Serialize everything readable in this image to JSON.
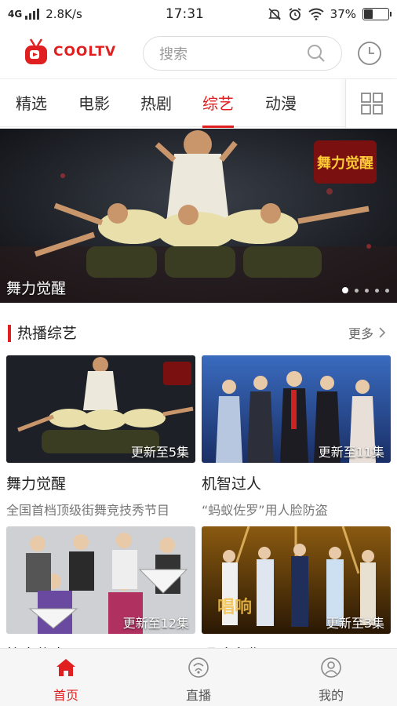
{
  "status_bar": {
    "network": "4G",
    "speed": "2.8K/s",
    "time": "17:31",
    "battery_text": "37%",
    "battery_level": 0.37
  },
  "header": {
    "logo_text": "COOLTV",
    "search_placeholder": "搜索"
  },
  "tabs": [
    {
      "label": "精选",
      "active": false
    },
    {
      "label": "电影",
      "active": false
    },
    {
      "label": "热剧",
      "active": false
    },
    {
      "label": "综艺",
      "active": true
    },
    {
      "label": "动漫",
      "active": false
    }
  ],
  "banner": {
    "caption": "舞力觉醒",
    "slide_count": 5,
    "active_slide": 1
  },
  "section": {
    "title": "热播综艺",
    "more_label": "更多"
  },
  "cards": [
    {
      "title": "舞力觉醒",
      "subtitle": "全国首档顶级街舞竞技秀节目",
      "badge": "更新至5集"
    },
    {
      "title": "机智过人",
      "subtitle": "“蚂蚁佐罗”用人脸防盗",
      "badge": "更新至11集"
    },
    {
      "title": "笑声传奇",
      "subtitle": "",
      "badge": "更新至12集"
    },
    {
      "title": "唱响中华",
      "subtitle": "",
      "badge": "更新至3集"
    }
  ],
  "bottom_nav": [
    {
      "label": "首页",
      "icon": "home-icon",
      "active": true
    },
    {
      "label": "直播",
      "icon": "live-icon",
      "active": false
    },
    {
      "label": "我的",
      "icon": "profile-icon",
      "active": false
    }
  ],
  "colors": {
    "accent": "#e02020"
  }
}
